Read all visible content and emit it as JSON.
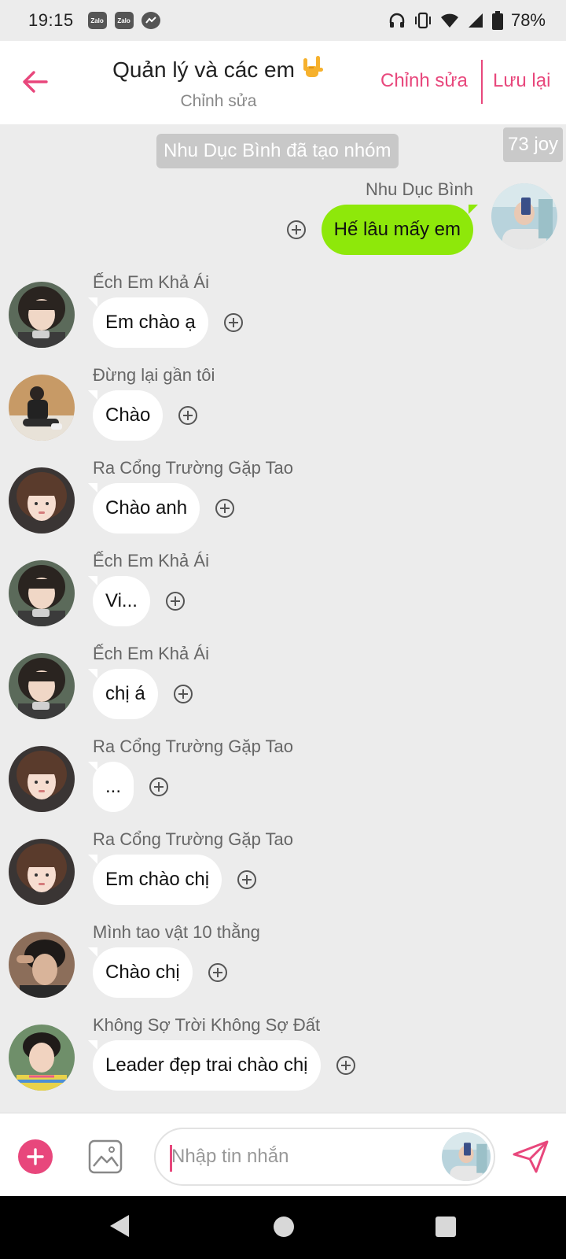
{
  "status_bar": {
    "time": "19:15",
    "notification_icons": [
      "zalo-icon",
      "zalo-icon",
      "messenger-icon"
    ],
    "system_icons": [
      "headphones-icon",
      "vibrate-icon",
      "wifi-icon",
      "signal-icon",
      "battery-icon"
    ],
    "battery": "78%"
  },
  "header": {
    "title": "Quản lý và các em",
    "title_emoji": "love-you-gesture-icon",
    "subtitle": "Chỉnh sửa",
    "edit_label": "Chỉnh sửa",
    "save_label": "Lưu lại"
  },
  "chat": {
    "system_notice": "Nhu Dục Bình đã tạo nhóm",
    "watermark": "73 joy",
    "messages": [
      {
        "sender": "Nhu Dục Bình",
        "text": "Hế lâu mấy em",
        "direction": "outgoing"
      },
      {
        "sender": "Ếch Em Khả Ái",
        "text": "Em chào ạ",
        "direction": "incoming"
      },
      {
        "sender": "Đừng lại gần tôi",
        "text": "Chào",
        "direction": "incoming"
      },
      {
        "sender": "Ra Cổng Trường Gặp Tao",
        "text": "Chào anh",
        "direction": "incoming"
      },
      {
        "sender": "Ếch Em Khả Ái",
        "text": "Vi...",
        "direction": "incoming"
      },
      {
        "sender": "Ếch Em Khả Ái",
        "text": "chị á",
        "direction": "incoming"
      },
      {
        "sender": "Ra Cổng Trường Gặp Tao",
        "text": "...",
        "direction": "incoming"
      },
      {
        "sender": "Ra Cổng Trường Gặp Tao",
        "text": "Em chào chị",
        "direction": "incoming"
      },
      {
        "sender": "Mình tao vật 10 thằng",
        "text": "Chào chị",
        "direction": "incoming"
      },
      {
        "sender": "Không Sợ Trời Không Sợ Đất",
        "text": "Leader đẹp trai chào chị",
        "direction": "incoming"
      }
    ]
  },
  "composer": {
    "placeholder": "Nhập tin nhắn"
  },
  "colors": {
    "accent": "#e8477c",
    "outgoing_bubble": "#8ee80a",
    "incoming_bubble": "#ffffff",
    "chat_background": "#ececec"
  }
}
